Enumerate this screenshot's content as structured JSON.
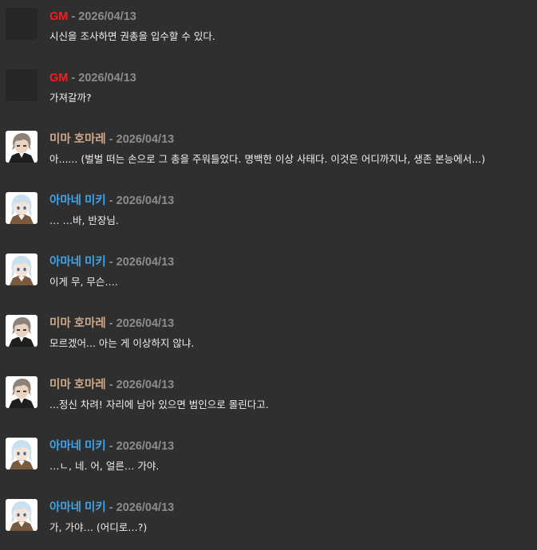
{
  "colors": {
    "background": "#2f2f2f",
    "gm": "#ff1a1a",
    "mima": "#cba98c",
    "amane": "#3fa3e8",
    "date": "#8c8c8c",
    "text": "#eeeeee"
  },
  "separator": "-",
  "messages": [
    {
      "speaker": "GM",
      "date": "2026/04/13",
      "text": "시신을 조사하면 권총을 입수할 수 있다.",
      "avatar": "blank-avatar",
      "color": "#ff1a1a"
    },
    {
      "speaker": "GM",
      "date": "2026/04/13",
      "text": "가져갈까?",
      "avatar": "blank-avatar",
      "color": "#ff1a1a"
    },
    {
      "speaker": "미마 호마레",
      "date": "2026/04/13",
      "text": "아...... (벌벌 떠는 손으로 그 총을 주워들었다. 명백한 이상 사태다. 이것은 어디까지나, 생존 본능에서...)",
      "avatar": "mima-avatar",
      "color": "#cba98c"
    },
    {
      "speaker": "아마네 미키",
      "date": "2026/04/13",
      "text": "… …바, 반장님.",
      "avatar": "amane-avatar",
      "color": "#3fa3e8"
    },
    {
      "speaker": "아마네 미키",
      "date": "2026/04/13",
      "text": "이게 무, 무슨….",
      "avatar": "amane-avatar",
      "color": "#3fa3e8"
    },
    {
      "speaker": "미마 호마레",
      "date": "2026/04/13",
      "text": "모르겠어... 아는 게 이상하지 않냐.",
      "avatar": "mima-avatar",
      "color": "#cba98c"
    },
    {
      "speaker": "미마 호마레",
      "date": "2026/04/13",
      "text": "...정신 차려! 자리에 남아 있으면 범인으로 몰린다고.",
      "avatar": "mima-avatar",
      "color": "#cba98c"
    },
    {
      "speaker": "아마네 미키",
      "date": "2026/04/13",
      "text": "…ㄴ, 네. 어, 얼른… 가야.",
      "avatar": "amane-avatar",
      "color": "#3fa3e8"
    },
    {
      "speaker": "아마네 미키",
      "date": "2026/04/13",
      "text": "가, 가야… (어디로…?)",
      "avatar": "amane-avatar",
      "color": "#3fa3e8"
    }
  ]
}
